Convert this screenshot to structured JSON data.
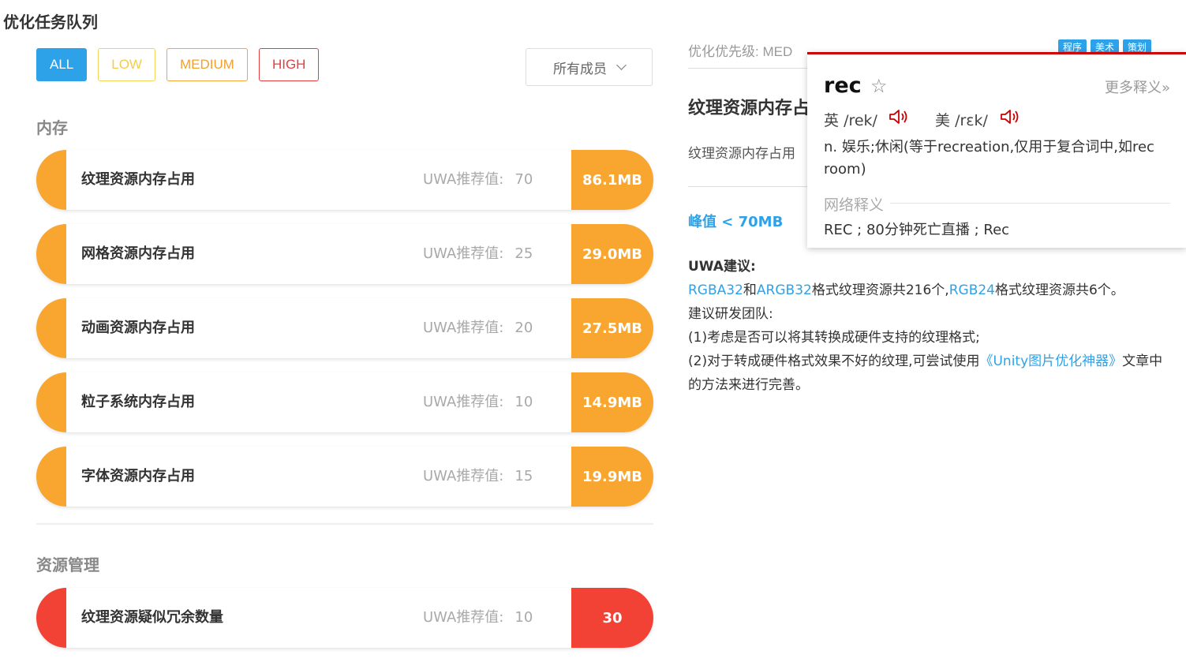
{
  "page_title": "优化任务队列",
  "filters": [
    {
      "label": "ALL",
      "active": true
    },
    {
      "label": "LOW"
    },
    {
      "label": "MEDIUM"
    },
    {
      "label": "HIGH"
    }
  ],
  "member_select": "所有成员",
  "sections": [
    {
      "title": "内存",
      "items": [
        {
          "name": "纹理资源内存占用",
          "rec_label": "UWA推荐值:",
          "rec_value": "70",
          "value": "86.1MB"
        },
        {
          "name": "网格资源内存占用",
          "rec_label": "UWA推荐值:",
          "rec_value": "25",
          "value": "29.0MB"
        },
        {
          "name": "动画资源内存占用",
          "rec_label": "UWA推荐值:",
          "rec_value": "20",
          "value": "27.5MB"
        },
        {
          "name": "粒子系统内存占用",
          "rec_label": "UWA推荐值:",
          "rec_value": "10",
          "value": "14.9MB"
        },
        {
          "name": "字体资源内存占用",
          "rec_label": "UWA推荐值:",
          "rec_value": "15",
          "value": "19.9MB"
        }
      ]
    },
    {
      "title": "资源管理",
      "items": [
        {
          "name": "纹理资源疑似冗余数量",
          "rec_label": "UWA推荐值:",
          "rec_value": "10",
          "value": "30"
        }
      ]
    }
  ],
  "detail": {
    "priority": "优化优先级: MED",
    "tags": [
      "程序",
      "美术",
      "策划"
    ],
    "title": "纹理资源内存占",
    "desc": "纹理资源内存占用",
    "peak": "峰值 < 70MB",
    "advice_label": "UWA建议:",
    "advice_p1": [
      "RGBA32",
      "和",
      "ARGB32",
      "格式纹理资源共216个,",
      "RGB24",
      "格式纹理资源共6个。"
    ],
    "advice_p2": "建议研发团队:",
    "advice_p3": "(1)考虑是否可以将其转换成硬件支持的纹理格式;",
    "advice_p4_pre": "(2)对于转成硬件格式效果不好的纹理,可尝试使用",
    "advice_p4_link": "《Unity图片优化神器》",
    "advice_p4_post": "文章中的方法来进行完善。"
  },
  "dictionary": {
    "word": "rec",
    "more": "更多释义»",
    "uk_label": "英",
    "uk_phonetic": "/rek/",
    "us_label": "美",
    "us_phonetic": "/rɛk/",
    "meaning": "n. 娱乐;休闲(等于recreation,仅用于复合词中,如rec room)",
    "net_title": "网络释义",
    "net": "REC ; 80分钟死亡直播 ; Rec"
  },
  "colors": {
    "accent": "#2ea2e8",
    "medium": "#f8a630",
    "high": "#f24236",
    "low": "#f2cd4a",
    "dict_border": "#cc0000"
  }
}
